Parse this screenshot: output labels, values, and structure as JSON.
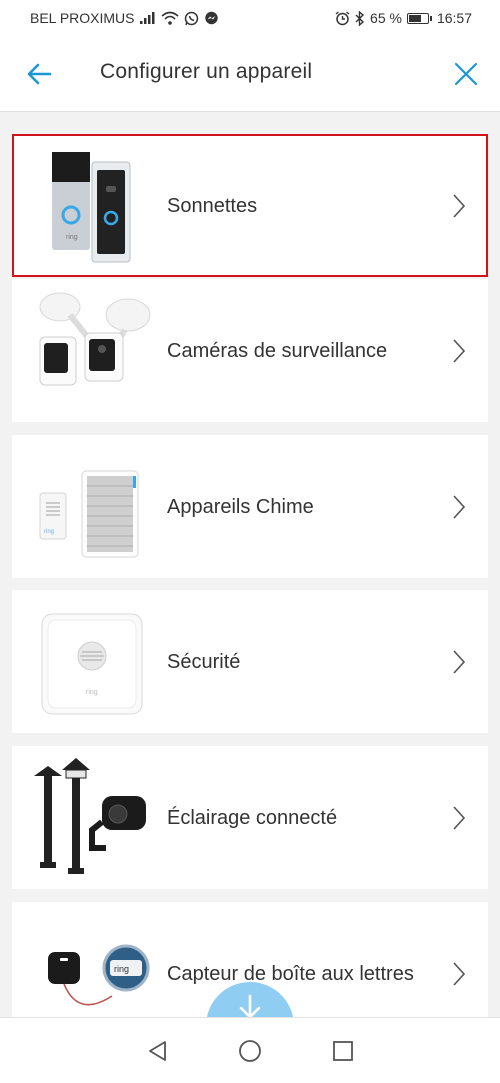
{
  "status_bar": {
    "carrier": "BEL PROXIMUS",
    "battery_percent": "65 %",
    "battery_level": 0.65,
    "time": "16:57",
    "icons": [
      "signal-icon",
      "wifi-icon",
      "whatsapp-icon",
      "messenger-icon",
      "alarm-icon",
      "bluetooth-icon",
      "battery-icon"
    ]
  },
  "header": {
    "title": "Configurer un appareil",
    "back_icon": "back-arrow-icon",
    "close_icon": "close-icon",
    "accent_color": "#1998d5"
  },
  "categories": [
    {
      "label": "Sonnettes",
      "icon": "doorbell-icon",
      "selected": true
    },
    {
      "label": "Caméras de surveillance",
      "icon": "security-camera-icon",
      "selected": false
    },
    {
      "label": "Appareils Chime",
      "icon": "chime-icon",
      "selected": false
    },
    {
      "label": "Sécurité",
      "icon": "alarm-base-station-icon",
      "selected": false
    },
    {
      "label": "Éclairage connecté",
      "icon": "smart-lighting-icon",
      "selected": false
    },
    {
      "label": "Capteur de boîte aux lettres",
      "icon": "mailbox-sensor-icon",
      "selected": false
    }
  ],
  "device_brand": "ring",
  "selection_color": "#d0131a",
  "fab": {
    "icon": "arrow-down-icon",
    "color": "#8fcdf3"
  },
  "nav_bar": {
    "icons": [
      "nav-back-icon",
      "nav-home-icon",
      "nav-recent-icon"
    ]
  }
}
